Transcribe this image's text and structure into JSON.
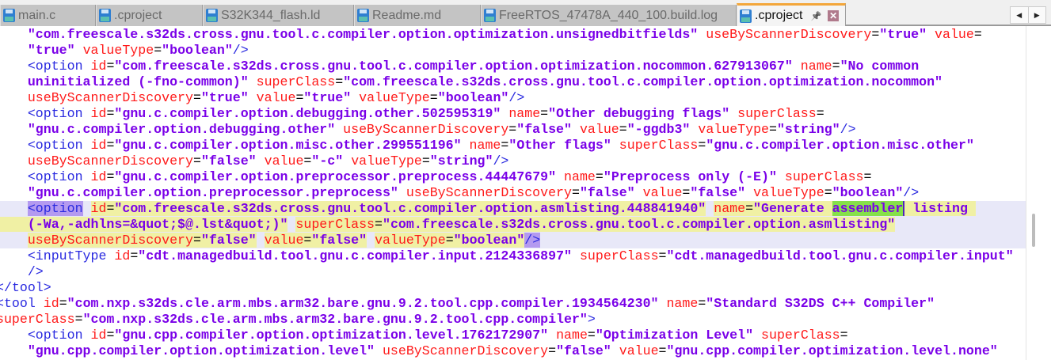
{
  "tabs": [
    {
      "label": "main.c",
      "active": false
    },
    {
      "label": ".cproject",
      "active": false
    },
    {
      "label": "S32K344_flash.ld",
      "active": false
    },
    {
      "label": "Readme.md",
      "active": false
    },
    {
      "label": "FreeRTOS_47478A_440_100.build.log",
      "active": false
    },
    {
      "label": ".cproject",
      "active": true
    }
  ],
  "tab_scroll": {
    "left": "◀",
    "right": "▶"
  },
  "active_tab_icons": {
    "pin": "📌",
    "close": "✕"
  },
  "colors": {
    "accent": "#f3a63a",
    "tag": "#2a2ae0",
    "attr": "#ff1a1a",
    "value": "#7a00e8",
    "highlight": "#f0f0a4",
    "match": "#86e04a"
  },
  "editor": {
    "search_match": "assembler",
    "highlighted_lines": [
      11,
      12,
      13
    ],
    "lines": [
      "    \"com.freescale.s32ds.cross.gnu.tool.c.compiler.option.optimization.unsignedbitfields\" useByScannerDiscovery=\"true\" value=",
      "    \"true\" valueType=\"boolean\"/>",
      "    <option id=\"com.freescale.s32ds.cross.gnu.tool.c.compiler.option.optimization.nocommon.627913067\" name=\"No common",
      "    uninitialized (-fno-common)\" superClass=\"com.freescale.s32ds.cross.gnu.tool.c.compiler.option.optimization.nocommon\"",
      "    useByScannerDiscovery=\"true\" value=\"true\" valueType=\"boolean\"/>",
      "    <option id=\"gnu.c.compiler.option.debugging.other.502595319\" name=\"Other debugging flags\" superClass=",
      "    \"gnu.c.compiler.option.debugging.other\" useByScannerDiscovery=\"false\" value=\"-ggdb3\" valueType=\"string\"/>",
      "    <option id=\"gnu.c.compiler.option.misc.other.299551196\" name=\"Other flags\" superClass=\"gnu.c.compiler.option.misc.other\"",
      "    useByScannerDiscovery=\"false\" value=\"-c\" valueType=\"string\"/>",
      "    <option id=\"gnu.c.compiler.option.preprocessor.preprocess.44447679\" name=\"Preprocess only (-E)\" superClass=",
      "    \"gnu.c.compiler.option.preprocessor.preprocess\" useByScannerDiscovery=\"false\" value=\"false\" valueType=\"boolean\"/>",
      "    <option id=\"com.freescale.s32ds.cross.gnu.tool.c.compiler.option.asmlisting.448841940\" name=\"Generate assembler listing ",
      "    (-Wa,-adhlns=&quot;$@.lst&quot;)\" superClass=\"com.freescale.s32ds.cross.gnu.tool.c.compiler.option.asmlisting\"",
      "    useByScannerDiscovery=\"false\" value=\"false\" valueType=\"boolean\"/>",
      "    <inputType id=\"cdt.managedbuild.tool.gnu.c.compiler.input.2124336897\" superClass=\"cdt.managedbuild.tool.gnu.c.compiler.input\"",
      "    />",
      "</tool>",
      "<tool id=\"com.nxp.s32ds.cle.arm.mbs.arm32.bare.gnu.9.2.tool.cpp.compiler.1934564230\" name=\"Standard S32DS C++ Compiler\"",
      "superClass=\"com.nxp.s32ds.cle.arm.mbs.arm32.bare.gnu.9.2.tool.cpp.compiler\">",
      "    <option id=\"gnu.cpp.compiler.option.optimization.level.1762172907\" name=\"Optimization Level\" superClass=",
      "    \"gnu.cpp.compiler.option.optimization.level\" useByScannerDiscovery=\"false\" value=\"gnu.cpp.compiler.optimization.level.none\""
    ]
  }
}
